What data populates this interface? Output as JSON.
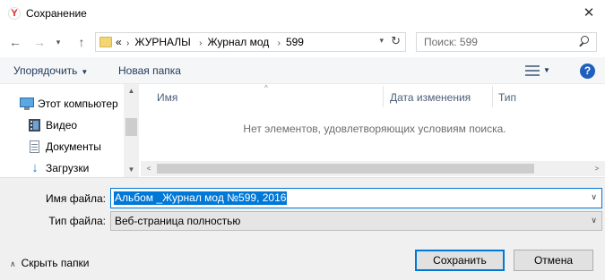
{
  "window": {
    "title": "Сохранение",
    "app_icon_letter": "Y",
    "close_glyph": "✕"
  },
  "navigation": {
    "back_glyph": "←",
    "forward_glyph": "→",
    "history_glyph": "▾",
    "up_glyph": "↑",
    "breadcrumb_overflow": "«",
    "breadcrumbs": [
      "ЖУРНАЛЫ",
      "Журнал мод",
      "599"
    ],
    "crumb_separator": "›",
    "refresh_glyph": "↻",
    "dropdown_glyph": "▾"
  },
  "search": {
    "placeholder": "Поиск: 599"
  },
  "toolbar": {
    "organize_label": "Упорядочить",
    "organize_caret": "▼",
    "new_folder_label": "Новая папка",
    "view_caret": "▼",
    "help_label": "?"
  },
  "sidebar": {
    "items": [
      {
        "label": "Этот компьютер",
        "icon": "computer-icon"
      },
      {
        "label": "Видео",
        "icon": "video-icon"
      },
      {
        "label": "Документы",
        "icon": "documents-icon"
      },
      {
        "label": "Загрузки",
        "icon": "downloads-icon"
      }
    ],
    "downloads_glyph": "↓",
    "scroll_up_glyph": "▲",
    "scroll_down_glyph": "▼"
  },
  "file_list": {
    "columns": [
      "Имя",
      "Дата изменения",
      "Тип"
    ],
    "sort_glyph": "^",
    "empty_message": "Нет элементов, удовлетворяющих условиям поиска.",
    "scroll_left_glyph": "<",
    "scroll_right_glyph": ">"
  },
  "form": {
    "filename_label": "Имя файла:",
    "filename_value": "Альбом _Журнал мод №599, 2016",
    "filetype_label": "Тип файла:",
    "filetype_value": "Веб-страница полностью",
    "dropdown_glyph": "∨"
  },
  "footer": {
    "hide_folders_label": "Скрыть папки",
    "hide_folders_glyph": "∧",
    "save_label": "Сохранить",
    "cancel_label": "Отмена"
  },
  "colors": {
    "accent": "#0078d7",
    "toolbar_bg": "#f5f6f7",
    "bottom_bg": "#f0f0f0",
    "link_text": "#1e395b"
  }
}
